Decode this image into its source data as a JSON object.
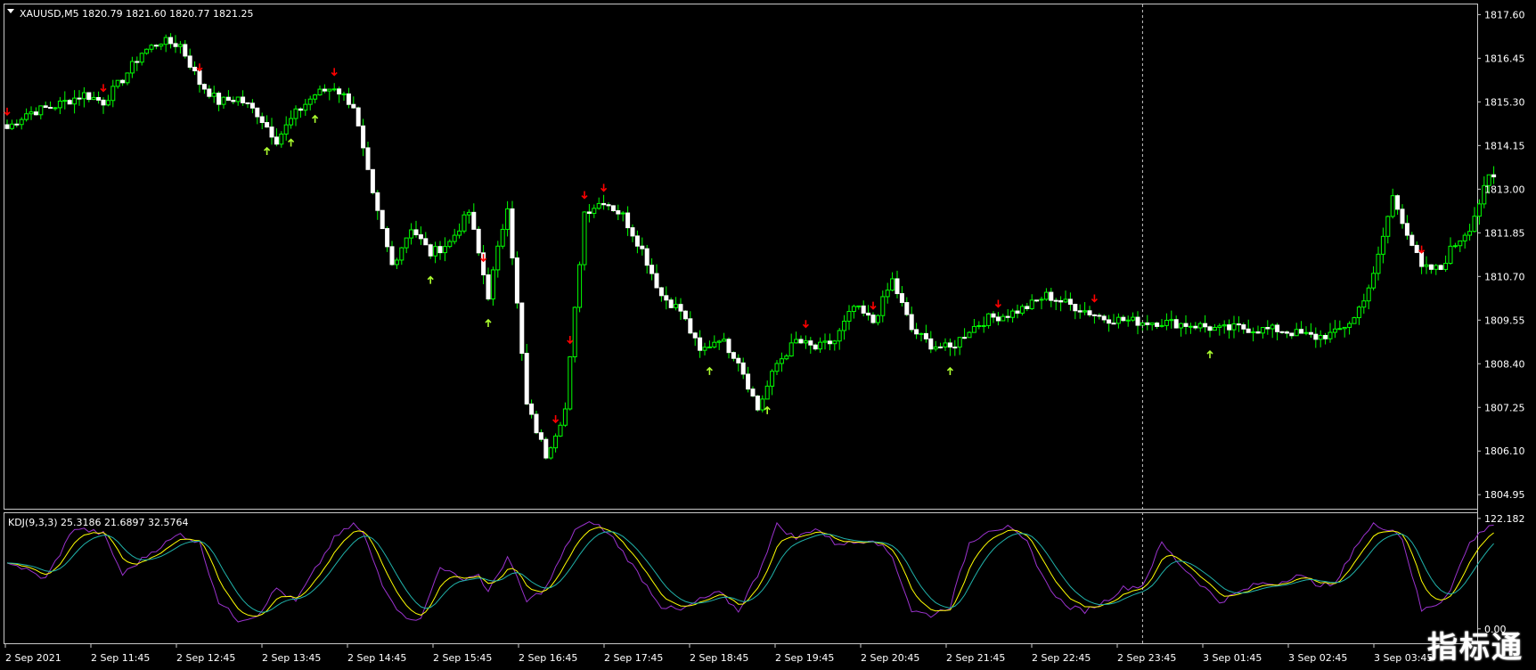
{
  "header": {
    "menu_icon": "triangle-down-icon",
    "symbol_info": "XAUUSD,M5  1820.79 1821.60 1820.77 1821.25"
  },
  "indicator": {
    "label": "KDJ(9,3,3) 25.3186 21.6897 32.5764"
  },
  "watermark": {
    "text": "指标通"
  },
  "colors": {
    "background": "#000000",
    "frame": "#c8c8c8",
    "bull_body": "#000000",
    "bull_border": "#00ff00",
    "bear_body": "#ffffff",
    "wick": "#00ff00",
    "arrow_up": "#adff2f",
    "arrow_down": "#ff0000",
    "k_line": "#9932cc",
    "d_line": "#ffff00",
    "j_line": "#20b2aa",
    "crosshair": "#c8c8c8"
  },
  "chart_data": [
    {
      "type": "candlestick",
      "symbol": "XAUUSD",
      "timeframe": "M5",
      "price_axis": {
        "ticks": [
          "1817.60",
          "1816.45",
          "1815.30",
          "1814.15",
          "1813.00",
          "1811.85",
          "1810.70",
          "1809.55",
          "1808.40",
          "1807.25",
          "1806.10",
          "1804.95"
        ],
        "ylim": [
          1804.65,
          1817.75
        ]
      },
      "time_axis": {
        "ticks": [
          "2 Sep 2021",
          "2 Sep 11:45",
          "2 Sep 12:45",
          "2 Sep 13:45",
          "2 Sep 14:45",
          "2 Sep 15:45",
          "2 Sep 16:45",
          "2 Sep 17:45",
          "2 Sep 18:45",
          "2 Sep 19:45",
          "2 Sep 20:45",
          "2 Sep 21:45",
          "2 Sep 22:45",
          "2 Sep 23:45",
          "3 Sep 01:45",
          "3 Sep 02:45",
          "3 Sep 03:45"
        ]
      },
      "close_anchors": [
        [
          0,
          1814.6
        ],
        [
          4,
          1815.0
        ],
        [
          10,
          1815.2
        ],
        [
          16,
          1815.5
        ],
        [
          20,
          1815.3
        ],
        [
          24,
          1815.9
        ],
        [
          28,
          1816.6
        ],
        [
          32,
          1816.9
        ],
        [
          36,
          1816.8
        ],
        [
          40,
          1815.8
        ],
        [
          44,
          1815.3
        ],
        [
          48,
          1815.4
        ],
        [
          52,
          1815.0
        ],
        [
          56,
          1814.3
        ],
        [
          60,
          1815.0
        ],
        [
          64,
          1815.5
        ],
        [
          68,
          1815.7
        ],
        [
          72,
          1815.2
        ],
        [
          76,
          1812.8
        ],
        [
          80,
          1811.0
        ],
        [
          84,
          1812.0
        ],
        [
          88,
          1811.3
        ],
        [
          92,
          1811.6
        ],
        [
          96,
          1812.4
        ],
        [
          100,
          1810.2
        ],
        [
          104,
          1812.6
        ],
        [
          108,
          1807.3
        ],
        [
          112,
          1806.0
        ],
        [
          116,
          1807.2
        ],
        [
          120,
          1812.4
        ],
        [
          124,
          1812.7
        ],
        [
          128,
          1812.3
        ],
        [
          132,
          1811.4
        ],
        [
          136,
          1810.2
        ],
        [
          140,
          1809.8
        ],
        [
          144,
          1808.7
        ],
        [
          148,
          1809.1
        ],
        [
          152,
          1808.5
        ],
        [
          156,
          1807.2
        ],
        [
          160,
          1808.4
        ],
        [
          164,
          1809.0
        ],
        [
          168,
          1808.8
        ],
        [
          172,
          1809.0
        ],
        [
          176,
          1809.9
        ],
        [
          180,
          1809.5
        ],
        [
          184,
          1810.6
        ],
        [
          188,
          1809.3
        ],
        [
          192,
          1808.9
        ],
        [
          196,
          1808.8
        ],
        [
          200,
          1809.3
        ],
        [
          204,
          1809.6
        ],
        [
          208,
          1809.7
        ],
        [
          212,
          1809.9
        ],
        [
          216,
          1810.2
        ],
        [
          220,
          1810.0
        ],
        [
          224,
          1809.8
        ],
        [
          228,
          1809.6
        ],
        [
          232,
          1809.55
        ],
        [
          236,
          1809.5
        ],
        [
          240,
          1809.5
        ],
        [
          244,
          1809.45
        ],
        [
          248,
          1809.4
        ],
        [
          252,
          1809.3
        ],
        [
          256,
          1809.35
        ],
        [
          260,
          1809.3
        ],
        [
          264,
          1809.3
        ],
        [
          268,
          1809.2
        ],
        [
          272,
          1809.1
        ],
        [
          276,
          1809.2
        ],
        [
          280,
          1809.6
        ],
        [
          284,
          1810.7
        ],
        [
          288,
          1812.8
        ],
        [
          290,
          1812.2
        ],
        [
          294,
          1810.9
        ],
        [
          298,
          1810.9
        ],
        [
          300,
          1811.4
        ],
        [
          304,
          1812.0
        ],
        [
          308,
          1813.3
        ]
      ],
      "down_signal_bars": [
        0,
        20,
        40,
        68,
        99,
        114,
        117,
        120,
        124,
        166,
        180,
        206,
        226,
        294
      ],
      "up_signal_bars": [
        54,
        59,
        64,
        88,
        100,
        146,
        158,
        196,
        250
      ],
      "crosshair_bar": 236
    },
    {
      "type": "line",
      "indicator": "KDJ(9,3,3)",
      "values_shown": [
        25.3186,
        21.6897,
        32.5764
      ],
      "y_axis": {
        "ticks": [
          "122.182",
          "0.00"
        ],
        "ylim": [
          -14,
          124
        ]
      },
      "k_anchors": [
        [
          0,
          75
        ],
        [
          8,
          55
        ],
        [
          14,
          112
        ],
        [
          20,
          105
        ],
        [
          24,
          60
        ],
        [
          30,
          85
        ],
        [
          36,
          105
        ],
        [
          40,
          95
        ],
        [
          44,
          30
        ],
        [
          48,
          10
        ],
        [
          52,
          15
        ],
        [
          56,
          45
        ],
        [
          60,
          30
        ],
        [
          64,
          65
        ],
        [
          68,
          100
        ],
        [
          72,
          116
        ],
        [
          74,
          105
        ],
        [
          78,
          50
        ],
        [
          82,
          15
        ],
        [
          86,
          10
        ],
        [
          90,
          70
        ],
        [
          94,
          55
        ],
        [
          98,
          60
        ],
        [
          100,
          40
        ],
        [
          104,
          80
        ],
        [
          108,
          30
        ],
        [
          112,
          45
        ],
        [
          118,
          110
        ],
        [
          122,
          118
        ],
        [
          126,
          100
        ],
        [
          130,
          70
        ],
        [
          136,
          25
        ],
        [
          140,
          20
        ],
        [
          144,
          32
        ],
        [
          148,
          40
        ],
        [
          152,
          20
        ],
        [
          156,
          60
        ],
        [
          160,
          115
        ],
        [
          164,
          100
        ],
        [
          168,
          112
        ],
        [
          172,
          95
        ],
        [
          176,
          95
        ],
        [
          180,
          100
        ],
        [
          184,
          80
        ],
        [
          188,
          20
        ],
        [
          192,
          15
        ],
        [
          196,
          25
        ],
        [
          200,
          95
        ],
        [
          204,
          110
        ],
        [
          208,
          112
        ],
        [
          212,
          95
        ],
        [
          216,
          50
        ],
        [
          220,
          25
        ],
        [
          224,
          20
        ],
        [
          228,
          30
        ],
        [
          232,
          45
        ],
        [
          236,
          48
        ],
        [
          240,
          95
        ],
        [
          244,
          70
        ],
        [
          248,
          50
        ],
        [
          252,
          30
        ],
        [
          256,
          40
        ],
        [
          260,
          50
        ],
        [
          264,
          50
        ],
        [
          268,
          60
        ],
        [
          272,
          50
        ],
        [
          276,
          48
        ],
        [
          280,
          90
        ],
        [
          284,
          115
        ],
        [
          288,
          110
        ],
        [
          290,
          100
        ],
        [
          294,
          20
        ],
        [
          298,
          30
        ],
        [
          300,
          45
        ],
        [
          304,
          95
        ],
        [
          308,
          115
        ]
      ]
    }
  ]
}
